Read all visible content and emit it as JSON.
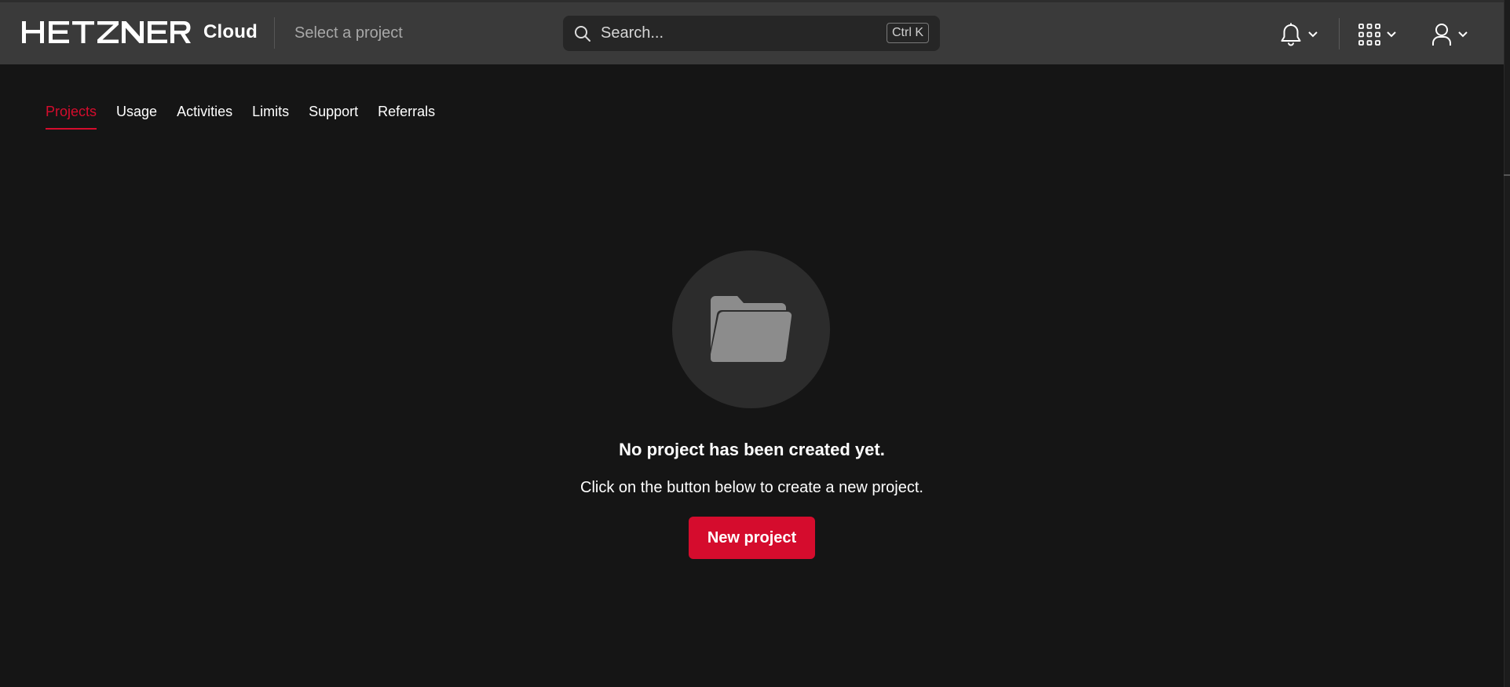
{
  "header": {
    "brand": {
      "logo_text": "HETZNER",
      "product": "Cloud"
    },
    "project_selector": "Select a project",
    "search": {
      "placeholder": "Search...",
      "shortcut": "Ctrl K"
    },
    "icons": {
      "notifications": "bell-icon",
      "apps": "grid-icon",
      "account": "user-icon"
    }
  },
  "tabs": [
    {
      "label": "Projects",
      "active": true
    },
    {
      "label": "Usage",
      "active": false
    },
    {
      "label": "Activities",
      "active": false
    },
    {
      "label": "Limits",
      "active": false
    },
    {
      "label": "Support",
      "active": false
    },
    {
      "label": "Referrals",
      "active": false
    }
  ],
  "empty_state": {
    "icon": "folder-icon",
    "title": "No project has been created yet.",
    "subtitle": "Click on the button below to create a new project.",
    "button_label": "New project"
  },
  "colors": {
    "accent": "#d50c2d",
    "background": "#151515",
    "header": "#3a3a3a"
  }
}
